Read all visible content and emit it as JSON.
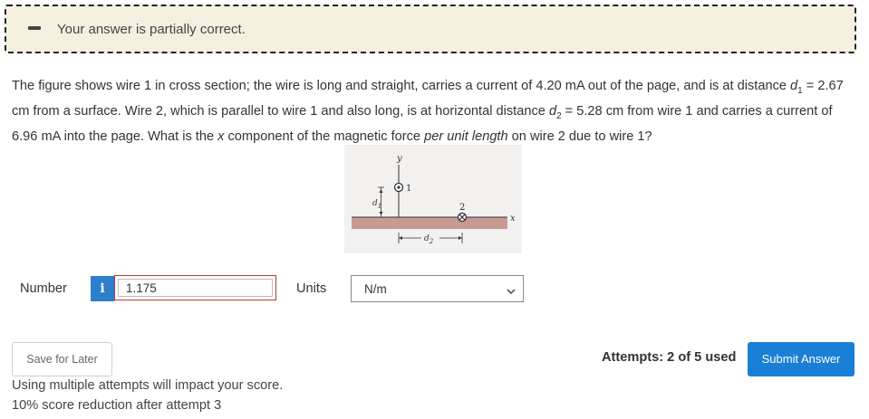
{
  "banner": {
    "message": "Your answer is partially correct."
  },
  "question": {
    "t1": "The figure shows wire 1 in cross section; the wire is long and straight, carries a current of 4.20 mA out of the page, and is at distance ",
    "d1_letter": "d",
    "d1_sub": "1",
    "t2": " = 2.67 cm from a surface. Wire 2, which is parallel to wire 1 and also long, is at horizontal distance ",
    "d2_letter": "d",
    "d2_sub": "2",
    "t3": " = 5.28 cm from wire 1 and carries a current of 6.96 mA into the page. What is the ",
    "x_letter": "x",
    "t4": " component of the magnetic force ",
    "per_unit": "per unit length",
    "t5": " on wire 2 due to wire 1?"
  },
  "figure": {
    "y_axis": "y",
    "x_axis": "x",
    "wire1_label": "1",
    "wire2_label": "2",
    "d1_label": "d",
    "d1_sub": "1",
    "d2_label": "d",
    "d2_sub": "2",
    "surface_color": "#c99a94",
    "background_color": "#f3f1ef"
  },
  "answer": {
    "number_label": "Number",
    "info_icon": "i",
    "value": "1.175",
    "units_label": "Units",
    "units_value": "N/m"
  },
  "actions": {
    "save_label": "Save for Later",
    "attempts": "Attempts: 2 of 5 used",
    "submit_label": "Submit Answer"
  },
  "notes": {
    "line1": "Using multiple attempts will impact your score.",
    "line2": "10% score reduction after attempt 3"
  }
}
